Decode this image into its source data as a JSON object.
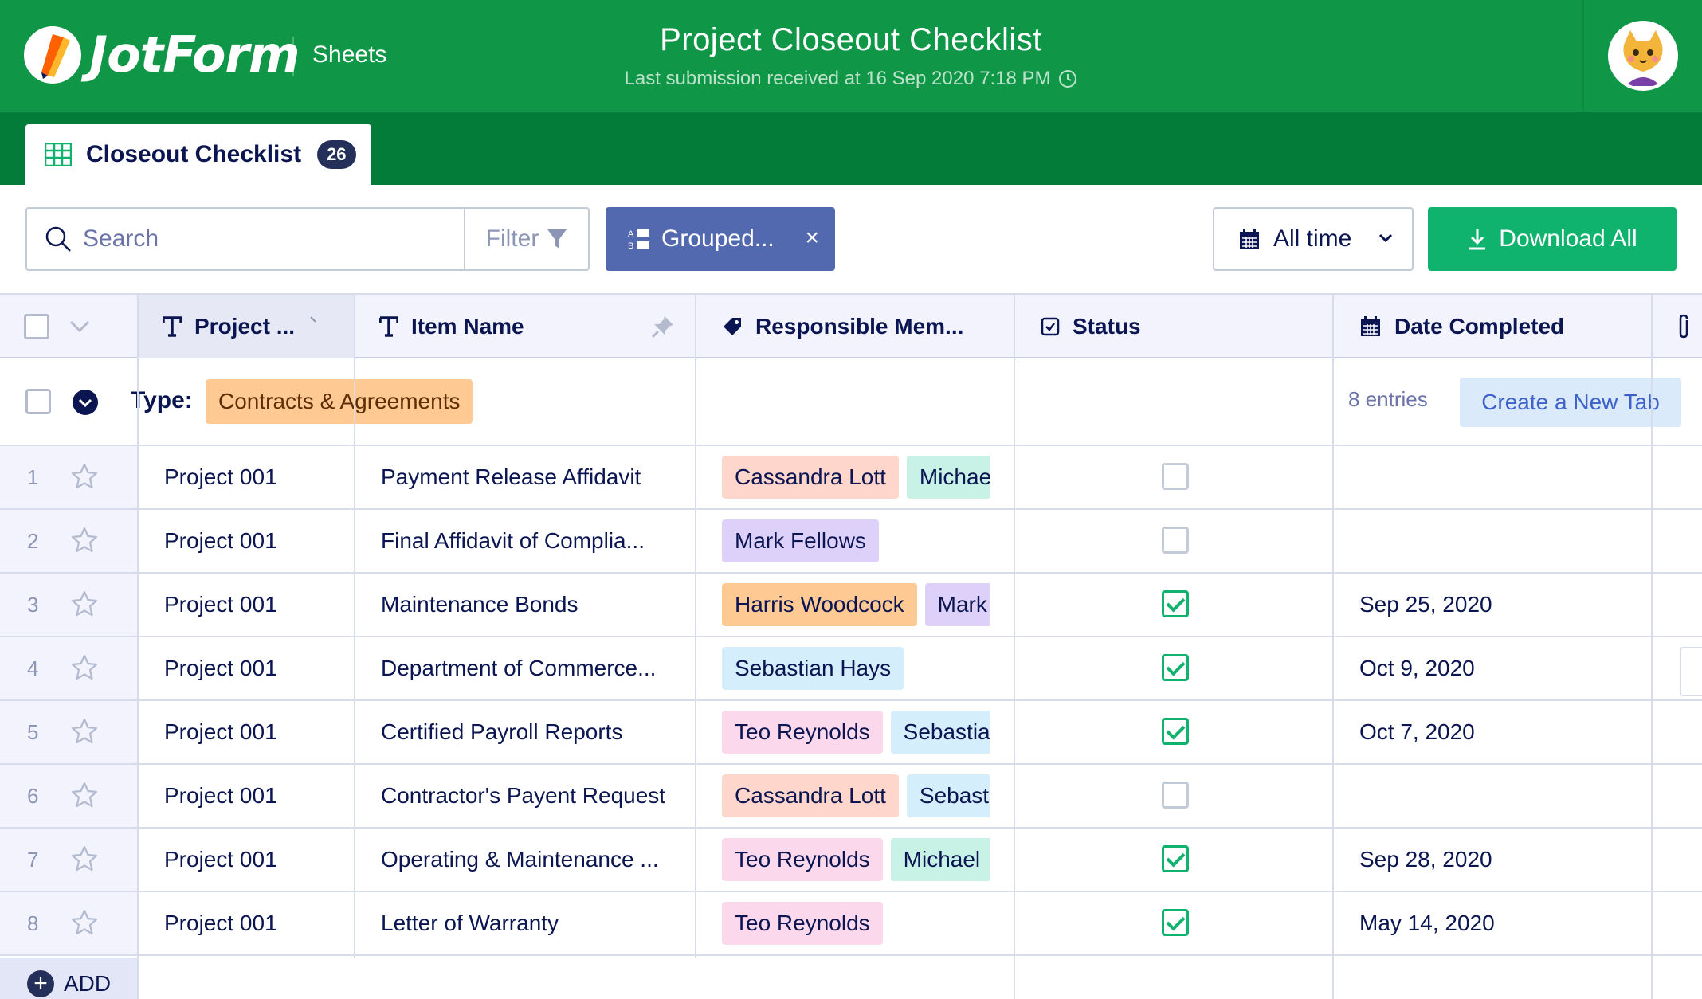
{
  "header": {
    "logo_text": "JotForm",
    "product": "Sheets",
    "title": "Project Closeout Checklist",
    "subtitle": "Last submission received at 16 Sep 2020 7:18 PM",
    "brand_color": "#0f9747"
  },
  "tab": {
    "label": "Closeout Checklist",
    "count": "26"
  },
  "toolbar": {
    "search_placeholder": "Search",
    "filter_label": "Filter",
    "grouped_label": "Grouped...",
    "grouped_close": "×",
    "time_label": "All time",
    "download_label": "Download All"
  },
  "columns": [
    {
      "label": "Project ...",
      "icon": "text-icon"
    },
    {
      "label": "Item Name",
      "icon": "text-icon"
    },
    {
      "label": "Responsible Mem...",
      "icon": "tag-icon"
    },
    {
      "label": "Status",
      "icon": "checkbox-icon"
    },
    {
      "label": "Date Completed",
      "icon": "calendar-icon"
    }
  ],
  "group": {
    "type_label": "Type:",
    "tag": "Contracts & Agreements",
    "entries": "8 entries",
    "new_tab_label": "Create a New Tab"
  },
  "rows": [
    {
      "num": "1",
      "project": "Project 001",
      "item": "Payment Release Affidavit",
      "members": [
        "Cassandra Lott",
        "Michae"
      ],
      "status": false,
      "date": ""
    },
    {
      "num": "2",
      "project": "Project 001",
      "item": "Final Affidavit of Complia...",
      "members": [
        "Mark Fellows"
      ],
      "status": false,
      "date": ""
    },
    {
      "num": "3",
      "project": "Project 001",
      "item": "Maintenance Bonds",
      "members": [
        "Harris Woodcock",
        "Mark"
      ],
      "status": true,
      "date": "Sep 25, 2020"
    },
    {
      "num": "4",
      "project": "Project 001",
      "item": "Department of Commerce...",
      "members": [
        "Sebastian Hays"
      ],
      "status": true,
      "date": "Oct 9, 2020"
    },
    {
      "num": "5",
      "project": "Project 001",
      "item": "Certified Payroll Reports",
      "members": [
        "Teo Reynolds",
        "Sebastia"
      ],
      "status": true,
      "date": "Oct 7, 2020"
    },
    {
      "num": "6",
      "project": "Project 001",
      "item": "Contractor's Payent Request",
      "members": [
        "Cassandra Lott",
        "Sebasti"
      ],
      "status": false,
      "date": ""
    },
    {
      "num": "7",
      "project": "Project 001",
      "item": "Operating & Maintenance ...",
      "members": [
        "Teo Reynolds",
        "Michael"
      ],
      "status": true,
      "date": "Sep 28, 2020"
    },
    {
      "num": "8",
      "project": "Project 001",
      "item": "Letter of Warranty",
      "members": [
        "Teo Reynolds"
      ],
      "status": true,
      "date": "May 14, 2020"
    }
  ],
  "member_colors": {
    "Cassandra Lott": "#ffd6cc",
    "Michae": "#c9f2e6",
    "Michael": "#c9f2e6",
    "Mark Fellows": "#ddd1fa",
    "Harris Woodcock": "#ffc993",
    "Mark": "#ddd1fa",
    "Sebastian Hays": "#d5eefb",
    "Sebastia": "#d5eefb",
    "Sebasti": "#d5eefb",
    "Teo Reynolds": "#fcd8ec"
  },
  "add_label": "ADD"
}
